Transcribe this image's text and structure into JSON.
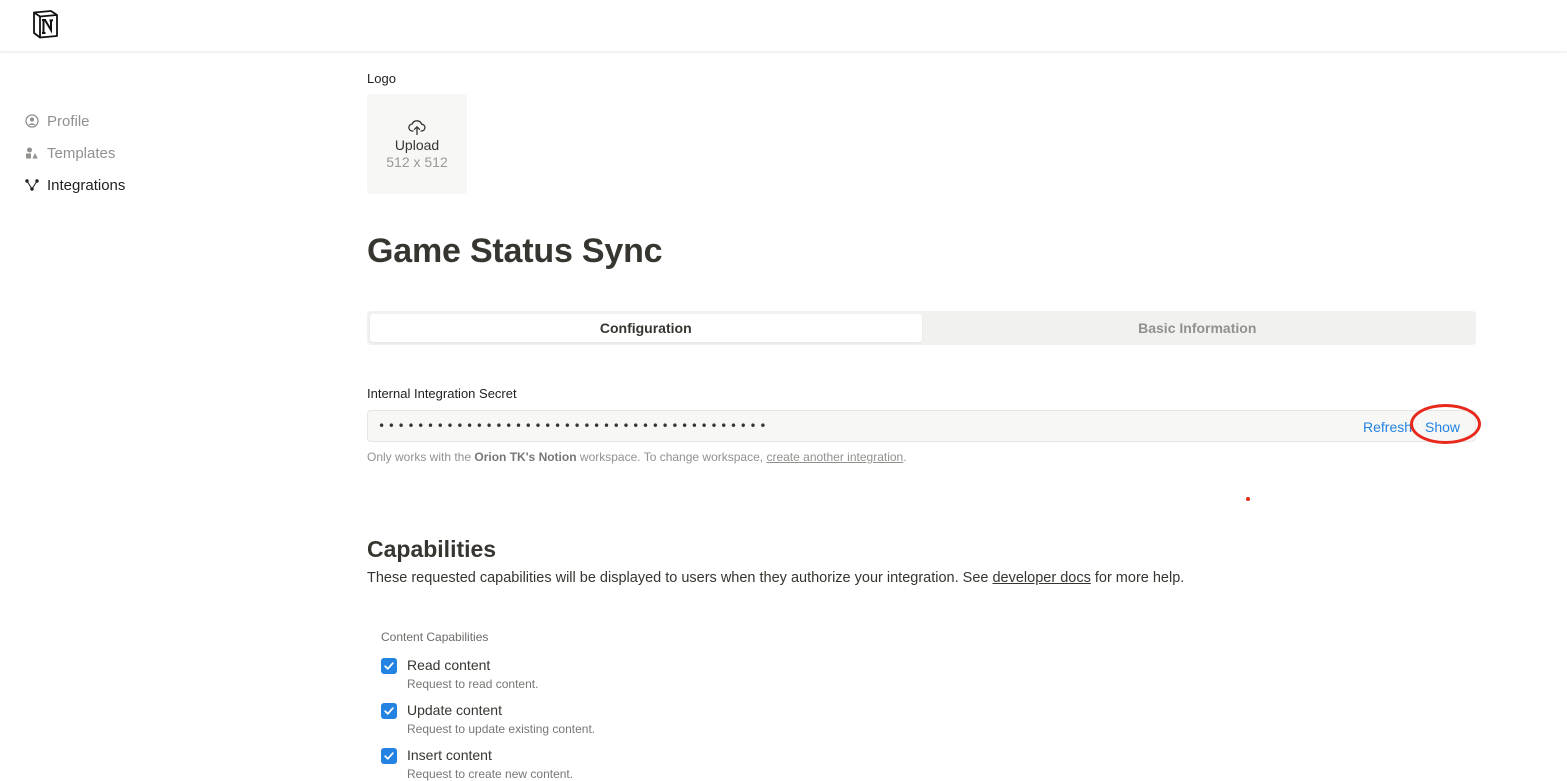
{
  "sidebar": {
    "items": [
      {
        "label": "Profile",
        "icon": "profile-icon"
      },
      {
        "label": "Templates",
        "icon": "templates-icon"
      },
      {
        "label": "Integrations",
        "icon": "integrations-icon",
        "active": true
      }
    ]
  },
  "logo": {
    "label": "Logo",
    "upload_text": "Upload",
    "size_text": "512 x 512"
  },
  "page": {
    "title": "Game Status Sync"
  },
  "tabs": [
    {
      "label": "Configuration",
      "active": true
    },
    {
      "label": "Basic Information",
      "active": false
    }
  ],
  "secret": {
    "label": "Internal Integration Secret",
    "masked_value": "••••••••••••••••••••••••••••••••••••••••",
    "refresh_label": "Refresh",
    "show_label": "Show",
    "note_prefix": "Only works with the ",
    "note_workspace": "Orion TK's Notion",
    "note_middle": " workspace. To change workspace, ",
    "note_link": "create another integration",
    "note_suffix": "."
  },
  "capabilities": {
    "title": "Capabilities",
    "desc_prefix": "These requested capabilities will be displayed to users when they authorize your integration. See ",
    "desc_link": "developer docs",
    "desc_suffix": " for more help.",
    "content_label": "Content Capabilities",
    "items": [
      {
        "name": "Read content",
        "desc": "Request to read content.",
        "checked": true
      },
      {
        "name": "Update content",
        "desc": "Request to update existing content.",
        "checked": true
      },
      {
        "name": "Insert content",
        "desc": "Request to create new content.",
        "checked": true
      }
    ]
  },
  "colors": {
    "accent": "#2383e2",
    "annotation": "#e8281b"
  }
}
